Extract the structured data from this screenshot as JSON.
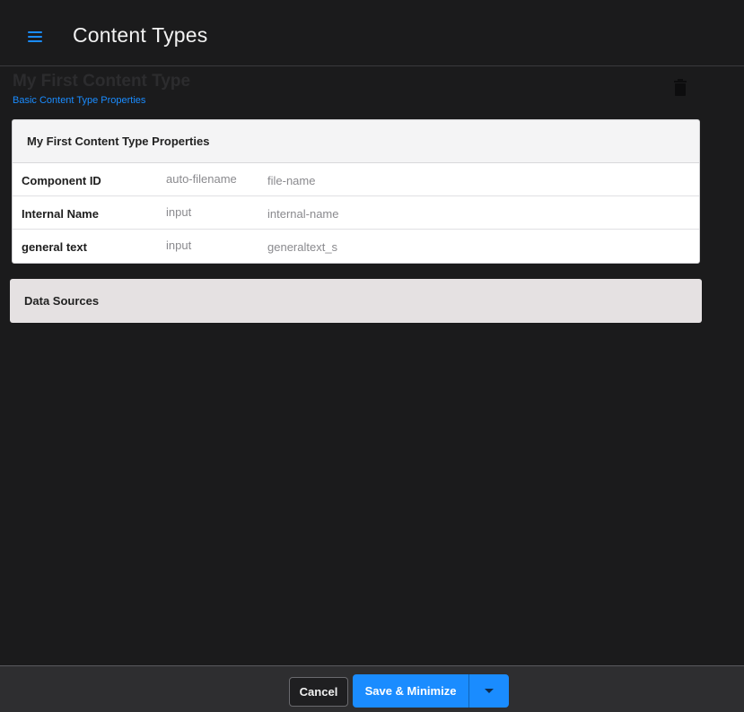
{
  "header": {
    "title": "Content Types"
  },
  "content_type": {
    "name": "My First Content Type",
    "subtitle": "Basic Content Type Properties"
  },
  "properties_panel": {
    "title": "My First Content Type Properties",
    "rows": [
      {
        "label": "Component ID",
        "type": "auto-filename",
        "id": "file-name"
      },
      {
        "label": "Internal Name",
        "type": "input",
        "id": "internal-name"
      },
      {
        "label": "general text",
        "type": "input",
        "id": "generaltext_s"
      }
    ]
  },
  "data_sources": {
    "title": "Data Sources"
  },
  "footer": {
    "cancel_label": "Cancel",
    "save_label": "Save & Minimize"
  },
  "colors": {
    "accent": "#1a8cff",
    "background": "#1b1b1c",
    "panel": "#ffffff",
    "data_sources_panel": "#e5e1e2"
  },
  "icons": [
    "menu-icon",
    "trash-icon",
    "caret-down-icon"
  ]
}
